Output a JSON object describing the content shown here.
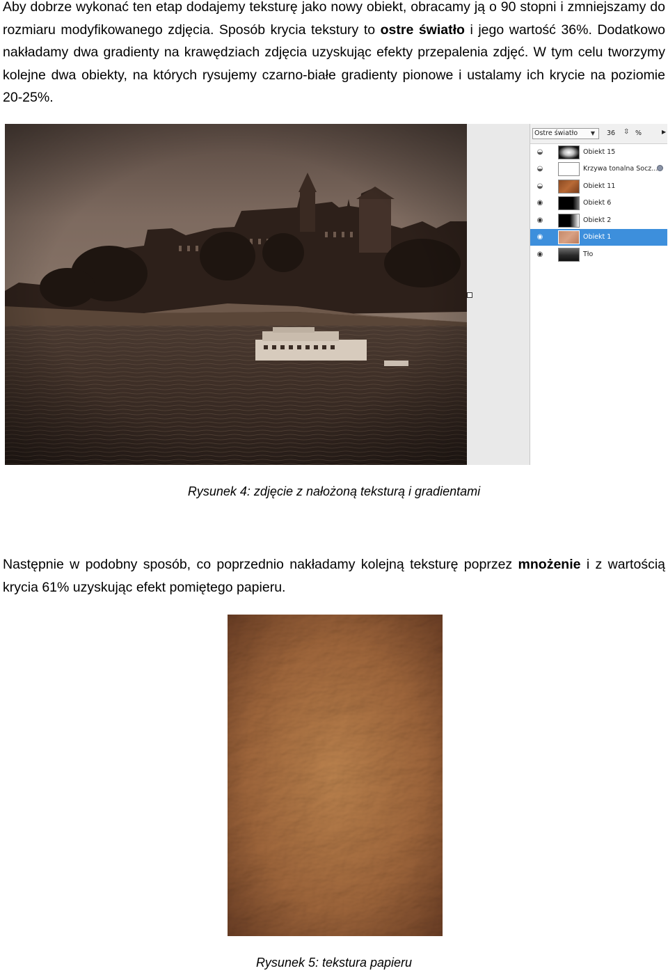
{
  "paragraph1": {
    "pre": "Aby dobrze wykonać ten etap dodajemy teksturę jako nowy obiekt, obracamy ją o 90 stopni i zmniejszamy do rozmiaru modyfikowanego zdjęcia. Sposób krycia tekstury to ",
    "bold": "ostre światło",
    "post": " i jego wartość 36%. Dodatkowo nakładamy dwa gradienty na krawędziach zdjęcia uzyskując efekty przepalenia zdjęć. W tym celu tworzymy kolejne dwa obiekty, na których rysujemy czarno-białe gradienty pionowe i ustalamy ich krycie na poziomie 20-25%."
  },
  "figure4": {
    "caption": "Rysunek 4: zdjęcie z nałożoną teksturą i gradientami",
    "layers_panel": {
      "blend_mode": "Ostre światło",
      "opacity_value": "36",
      "stepper_icon": "stepper-arrows-icon",
      "percent_label": "%",
      "layers": [
        {
          "name": "Obiekt 15",
          "visible": false,
          "selected": false,
          "thumb": "radial-white"
        },
        {
          "name": "Krzywa tonalna Socz....",
          "visible": false,
          "selected": false,
          "thumb": "white",
          "badge": "adjustment-icon"
        },
        {
          "name": "Obiekt 11",
          "visible": false,
          "selected": false,
          "thumb": "rust-texture"
        },
        {
          "name": "Obiekt 6",
          "visible": true,
          "selected": false,
          "thumb": "black-white-gradient-left"
        },
        {
          "name": "Obiekt 2",
          "visible": true,
          "selected": false,
          "thumb": "black-white-gradient-right"
        },
        {
          "name": "Obiekt 1",
          "visible": true,
          "selected": true,
          "thumb": "brown-texture"
        },
        {
          "name": "Tło",
          "visible": true,
          "selected": false,
          "thumb": "photo"
        }
      ]
    }
  },
  "paragraph2": {
    "pre": "Następnie w podobny sposób, co poprzednio nakładamy kolejną teksturę poprzez ",
    "bold": "mnożenie",
    "post": " i z wartością krycia 61% uzyskując efekt pomiętego papieru."
  },
  "figure5": {
    "caption": "Rysunek 5: tekstura papieru"
  },
  "colors": {
    "selection": "#3d8fdc",
    "sepia_dark": "#3a2a20",
    "paper_mid": "#a0683c"
  }
}
